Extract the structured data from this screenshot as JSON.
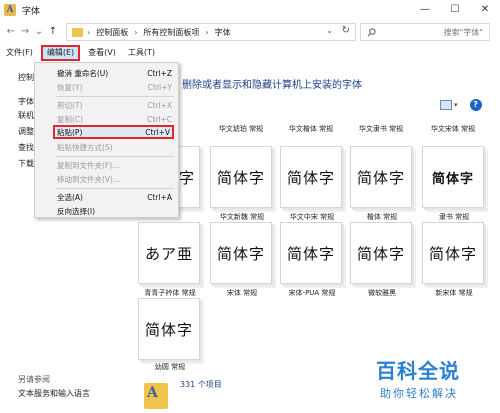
{
  "window": {
    "title": "字体",
    "app_icon_letter": "A",
    "controls": [
      "—",
      "☐",
      "✕"
    ]
  },
  "nav": {
    "back": "←",
    "forward": "→",
    "recent": "⌄",
    "up": "↑"
  },
  "address": {
    "crumbs": [
      "控制面板",
      "所有控制面板项",
      "字体"
    ],
    "separator": "›",
    "dropdown": "⌄",
    "refresh": "↻"
  },
  "search": {
    "placeholder": "搜索\"字体\"",
    "icon": "search-icon"
  },
  "menubar": {
    "items": [
      "文件(F)",
      "编辑(E)",
      "查看(V)",
      "工具(T)"
    ],
    "active_index": 1
  },
  "edit_menu": {
    "items": [
      {
        "label": "撤消 重命名(U)",
        "shortcut": "Ctrl+Z",
        "disabled": false
      },
      {
        "label": "恢复(Y)",
        "shortcut": "Ctrl+Y",
        "disabled": true
      },
      {
        "label": "剪切(T)",
        "shortcut": "Ctrl+X",
        "disabled": true
      },
      {
        "label": "复制(C)",
        "shortcut": "Ctrl+C",
        "disabled": true
      },
      {
        "label": "粘贴(P)",
        "shortcut": "Ctrl+V",
        "disabled": false,
        "highlighted": true
      },
      {
        "label": "粘贴快捷方式(S)",
        "shortcut": "",
        "disabled": true
      },
      {
        "label": "复制到文件夹(F)...",
        "shortcut": "",
        "disabled": true
      },
      {
        "label": "移动到文件夹(V)...",
        "shortcut": "",
        "disabled": true
      },
      {
        "label": "全选(A)",
        "shortcut": "Ctrl+A",
        "disabled": false
      },
      {
        "label": "反向选择(I)",
        "shortcut": "",
        "disabled": false
      }
    ]
  },
  "left_pane": {
    "links": [
      "控制",
      "字体",
      "联机",
      "调整",
      "查找",
      "下载"
    ],
    "see_also_title": "另请参阅",
    "see_also_link": "文本服务和输入语言"
  },
  "main": {
    "heading": "删除或者显示和隐藏计算机上安装的字体",
    "help": "?",
    "top_row_labels": [
      "华文琥珀 常规",
      "华文楷体 常规",
      "华文隶书 常规",
      "华文宋体 常规"
    ],
    "fonts": [
      {
        "sample": "简体字",
        "label": "华文新魏 常规",
        "style": "serif"
      },
      {
        "sample": "简体字",
        "label": "华文中宋 常规",
        "style": "sans"
      },
      {
        "sample": "简体字",
        "label": "楷体 常规",
        "style": "serif"
      },
      {
        "sample": "简体字",
        "label": "隶书 常规",
        "style": "bold"
      },
      {
        "sample": "あア亜",
        "label": "青青子衿体 常规",
        "style": "serif"
      },
      {
        "sample": "简体字",
        "label": "宋体 常规",
        "style": "sans"
      },
      {
        "sample": "简体字",
        "label": "宋体-PUA 常规",
        "style": "sans"
      },
      {
        "sample": "简体字",
        "label": "微软雅黑",
        "style": "sans"
      },
      {
        "sample": "简体字",
        "label": "新宋体 常规",
        "style": "sans"
      },
      {
        "sample": "简体字",
        "label": "幼圆 常规",
        "style": "sans"
      }
    ]
  },
  "status": {
    "count": "331 个项目"
  },
  "watermark": {
    "main": "百科全说",
    "sub": "助你轻松解决"
  }
}
